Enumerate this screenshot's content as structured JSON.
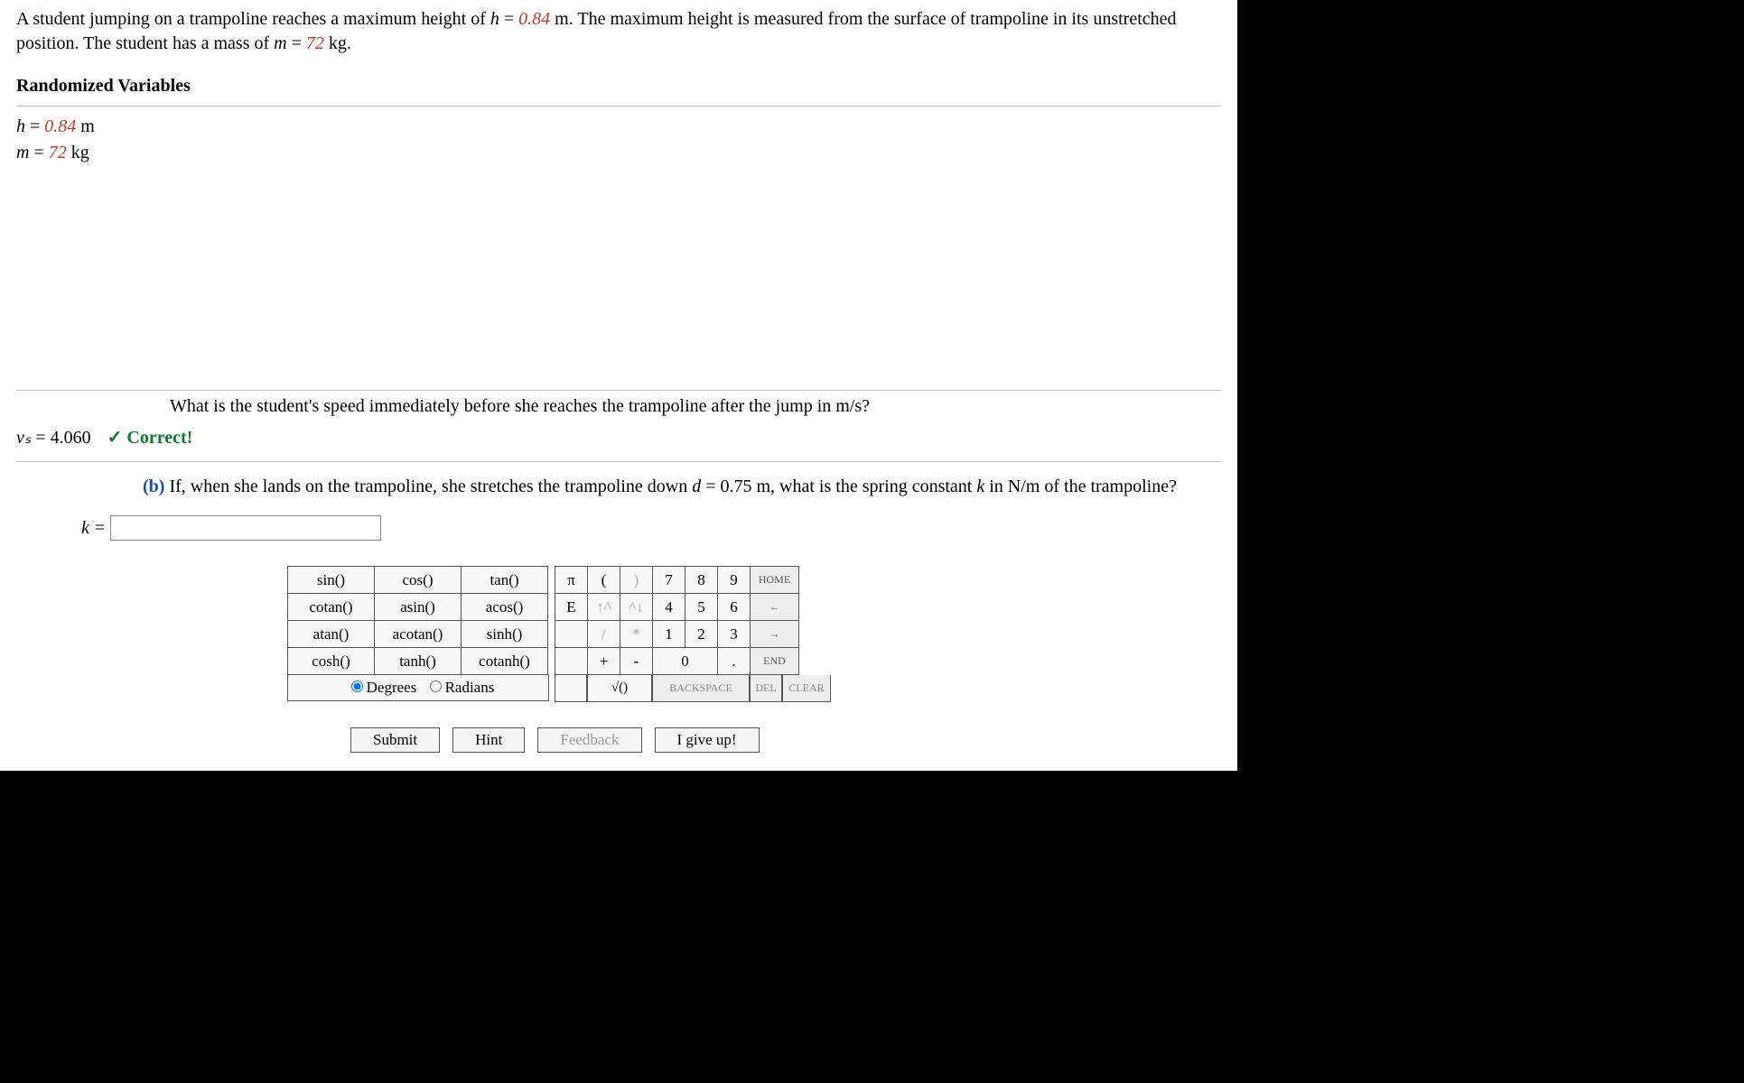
{
  "problem": {
    "intro_prefix": "A student jumping on a trampoline reaches a maximum height of ",
    "h_label": "h",
    "h_eq": " = ",
    "h_val": "0.84",
    "h_unit": " m. ",
    "intro_mid": "The maximum height is measured from the surface of trampoline in its unstretched position. The student has a mass of ",
    "m_label": "m",
    "m_eq": " = ",
    "m_val": "72",
    "m_unit": " kg."
  },
  "randomized_title": "Randomized Variables",
  "vars": {
    "h_line_a": "h",
    "h_line_b": " = ",
    "h_line_c": "0.84",
    "h_line_d": " m",
    "m_line_a": "m",
    "m_line_b": " = ",
    "m_line_c": "72",
    "m_line_d": " kg"
  },
  "part_a": {
    "question": "What is the student's speed immediately before she reaches the trampoline after the jump in m/s?",
    "vs_label": "vₛ",
    "vs_value": " = 4.060",
    "check": "✓",
    "correct": " Correct!"
  },
  "part_b": {
    "label": "(b)",
    "question_a": "  If, when she lands on the trampoline, she stretches the trampoline down ",
    "d_label": "d",
    "d_eq": " = 0.75 m, what is the spring constant ",
    "k_label": "k",
    "tail": " in N/m of the trampoline?",
    "answer_label": "k",
    "answer_eq": " = ",
    "answer_value": ""
  },
  "calc": {
    "funcs": [
      [
        "sin()",
        "cos()",
        "tan()"
      ],
      [
        "cotan()",
        "asin()",
        "acos()"
      ],
      [
        "atan()",
        "acotan()",
        "sinh()"
      ],
      [
        "cosh()",
        "tanh()",
        "cotanh()"
      ]
    ],
    "sym_col": [
      "π",
      "E",
      "",
      ""
    ],
    "sym2_col": [
      "(",
      "↑^",
      "/",
      "+"
    ],
    "sym3_col": [
      ")",
      "^↓",
      "*",
      "-"
    ],
    "num_rows": [
      [
        "7",
        "8",
        "9"
      ],
      [
        "4",
        "5",
        "6"
      ],
      [
        "1",
        "2",
        "3"
      ]
    ],
    "zero_row": [
      "0",
      "."
    ],
    "right_col": [
      "HOME",
      "←",
      "→",
      "END"
    ],
    "sqrt": "√()",
    "backspace": "BACKSPACE",
    "del": "DEL",
    "clear": "CLEAR",
    "degrees": "Degrees",
    "radians": "Radians"
  },
  "buttons": {
    "submit": "Submit",
    "hint": "Hint",
    "feedback": "Feedback",
    "giveup": "I give up!"
  }
}
